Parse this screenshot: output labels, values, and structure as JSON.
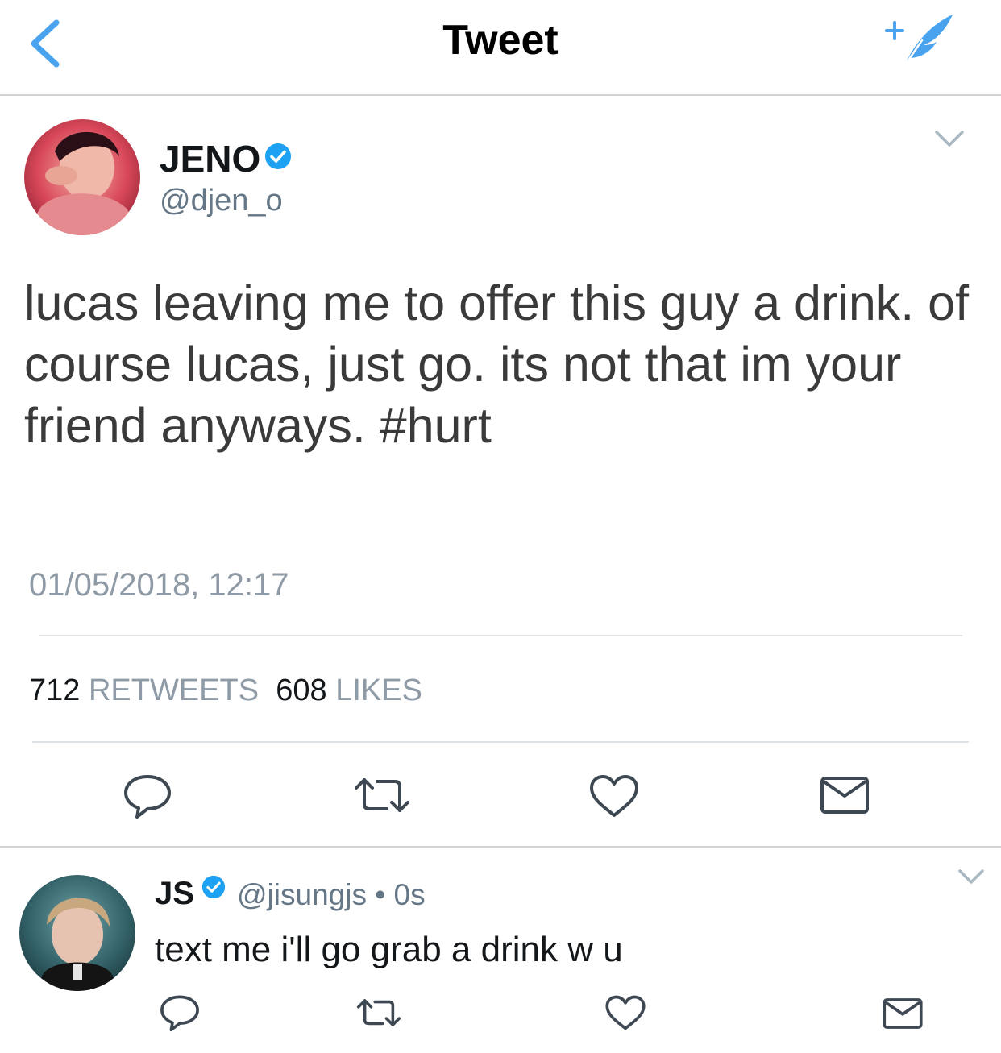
{
  "header": {
    "title": "Tweet",
    "back_icon": "chevron-left-icon",
    "compose_icon": "compose-tweet-icon",
    "accent_color": "#4aa3ef"
  },
  "tweet": {
    "author_name": "JENO",
    "author_handle": "@djen_o",
    "verified": true,
    "text": "lucas leaving me to offer this guy a drink. of course lucas, just go. its not that im your friend anyways.",
    "hashtag": "#hurt",
    "timestamp": "01/05/2018, 12:17",
    "retweet_count": "712",
    "retweet_label": "RETWEETS",
    "like_count": "608",
    "like_label": "LIKES",
    "actions": [
      "reply-icon",
      "retweet-icon",
      "like-icon",
      "direct-message-icon"
    ]
  },
  "reply": {
    "author_name": "JS",
    "author_handle": "@jisungjs",
    "separator": "•",
    "time": "0s",
    "verified": true,
    "text": "text me i'll go grab a drink w u",
    "actions": [
      "reply-icon",
      "retweet-icon",
      "like-icon",
      "direct-message-icon"
    ]
  },
  "colors": {
    "verified_blue": "#1da1f2",
    "icon_gray": "#3d4852",
    "secondary_text": "#8e9aa5"
  }
}
